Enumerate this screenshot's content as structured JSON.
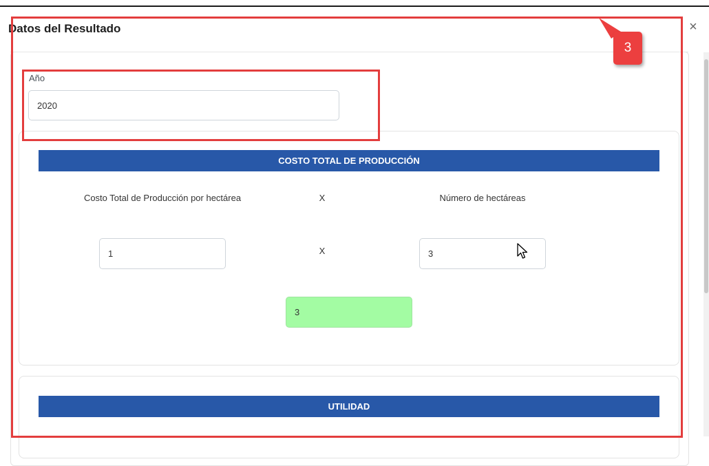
{
  "modal": {
    "title": "Datos del Resultado",
    "close_symbol": "×"
  },
  "year_field": {
    "label": "Año",
    "value": "2020"
  },
  "cost_section": {
    "header": "COSTO TOTAL DE PRODUCCIÓN",
    "col_cost_label": "Costo Total de Producción por hectárea",
    "operator_label": "X",
    "col_hectares_label": "Número de hectáreas",
    "cost_value": "1",
    "operator_value": "X",
    "hectares_value": "3",
    "result_value": "3"
  },
  "utility_section": {
    "header": "UTILIDAD"
  },
  "annotation": {
    "badge_number": "3",
    "color": "#e33d3d"
  },
  "colors": {
    "section_bar": "#2858a8",
    "result_bg": "#a3fca3"
  },
  "icons": [
    "close-icon",
    "mouse-pointer-icon"
  ]
}
